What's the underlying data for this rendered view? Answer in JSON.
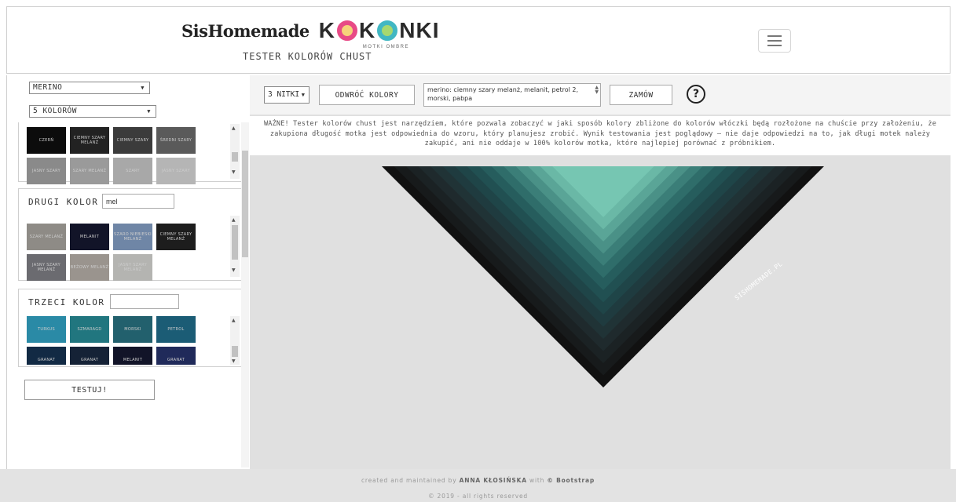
{
  "header": {
    "brand_sis": "SisHomemade",
    "brand_kokonki": [
      "K",
      "K",
      "NKI"
    ],
    "brand_sub": "MOTKI OMBRE",
    "title": "TESTER KOLORÓW CHUST"
  },
  "sidebar": {
    "yarn_select": "MERINO",
    "count_select": "5 KOLORÓW",
    "first_panel": {
      "swatches": [
        {
          "label": "CZERŃ",
          "color": "#0c0c0c"
        },
        {
          "label": "CIEMNY SZARY MELANŻ",
          "color": "#222222"
        },
        {
          "label": "CIEMNY SZARY",
          "color": "#3b3b3b"
        },
        {
          "label": "ŚREDNI SZARY",
          "color": "#5a5a5a"
        },
        {
          "label": "JASNY SZARY",
          "color": "#8a8a8a"
        },
        {
          "label": "SZARY MELANŻ",
          "color": "#9a9a9a"
        },
        {
          "label": "SZARY",
          "color": "#a8a8a8"
        },
        {
          "label": "JASNY SZARY",
          "color": "#b5b5b5"
        }
      ]
    },
    "second_panel": {
      "title": "DRUGI KOLOR",
      "search_value": "mel",
      "swatches": [
        {
          "label": "SZARY MELANŻ",
          "color": "#8e8b86"
        },
        {
          "label": "MELANIT",
          "color": "#121428"
        },
        {
          "label": "SZARO NIEBIESKI MELANŻ",
          "color": "#6f86a6"
        },
        {
          "label": "CIEMNY SZARY MELANŻ",
          "color": "#1d1d1d"
        },
        {
          "label": "JASNY SZARY MELANŻ",
          "color": "#6b6b70"
        },
        {
          "label": "BEŻOWY MELANŻ",
          "color": "#9a948e"
        },
        {
          "label": "JASNY SZARY MELANŻ",
          "color": "#b4b4b1"
        }
      ]
    },
    "third_panel": {
      "title": "TRZECI KOLOR",
      "search_value": "",
      "swatches": [
        {
          "label": "TURKUS",
          "color": "#2a8aa6"
        },
        {
          "label": "SZMARAGD",
          "color": "#21767f"
        },
        {
          "label": "MORSKI",
          "color": "#22606d"
        },
        {
          "label": "PETROL",
          "color": "#1b5c75"
        },
        {
          "label": "GRANAT",
          "color": "#122a44"
        },
        {
          "label": "GRANAT",
          "color": "#152236"
        },
        {
          "label": "MELANIT",
          "color": "#121428"
        },
        {
          "label": "GRANAT",
          "color": "#202a5a"
        }
      ]
    },
    "test_button": "TESTUJ!"
  },
  "toolbar": {
    "threads_select": "3 NITKI",
    "reverse_button": "ODWRÓĆ KOLORY",
    "colors_text": "merino: ciemny szary melanż, melanit, petrol 2, morski, pabpa",
    "order_button": "ZAMÓW",
    "help": "?"
  },
  "notice": "WAŻNE! Tester kolorów chust jest narzędziem, które pozwala zobaczyć w jaki sposób kolory zbliżone do kolorów włóczki będą rozłożone na chuście przy założeniu, że zakupiona długość motka jest odpowiednia do wzoru, który planujesz zrobić. Wynik testowania jest poglądowy – nie daje odpowiedzi na to, jak długi motek należy zakupić, ani nie oddaje w 100% kolorów motka, które najlepiej porównać z próbnikiem.",
  "shawl": {
    "watermark": "SISHOMEMADE.PL",
    "band_colors": [
      "#111111",
      "#171a1b",
      "#1b2224",
      "#1f2a2d",
      "#203336",
      "#1f3b3f",
      "#1f4548",
      "#215052",
      "#265d5d",
      "#2f6d6a",
      "#3b7e78",
      "#4a9187",
      "#5aa597",
      "#6ab8a6",
      "#76c6b2"
    ]
  },
  "footer": {
    "line1_pre": "created and maintained by",
    "author": "ANNA KŁOSIŃSKA",
    "with": "with",
    "tool": "© Bootstrap",
    "line2": "© 2019 - all rights reserved"
  },
  "colors": {
    "main_bg": "#e0e0e0",
    "footer_bg": "#e3e3e3"
  }
}
